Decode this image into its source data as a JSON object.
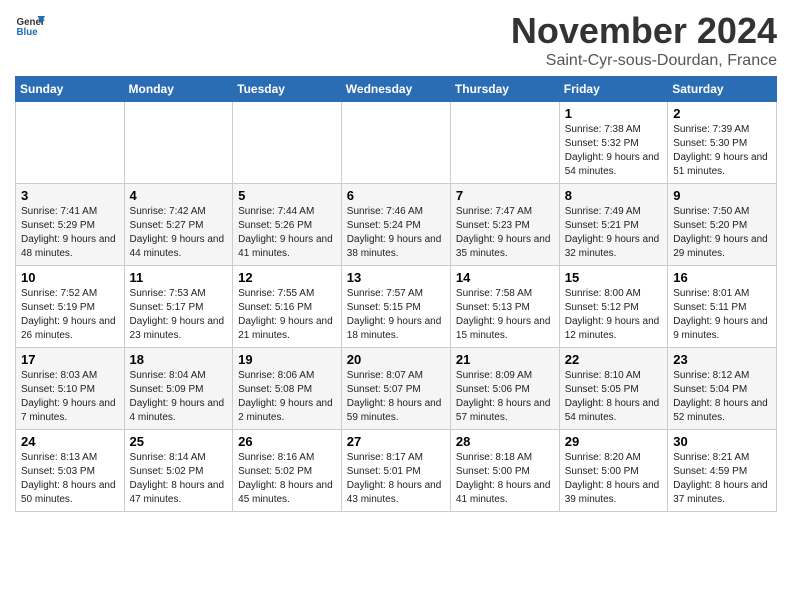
{
  "header": {
    "logo_line1": "General",
    "logo_line2": "Blue",
    "month": "November 2024",
    "location": "Saint-Cyr-sous-Dourdan, France"
  },
  "weekdays": [
    "Sunday",
    "Monday",
    "Tuesday",
    "Wednesday",
    "Thursday",
    "Friday",
    "Saturday"
  ],
  "weeks": [
    [
      {
        "day": "",
        "info": ""
      },
      {
        "day": "",
        "info": ""
      },
      {
        "day": "",
        "info": ""
      },
      {
        "day": "",
        "info": ""
      },
      {
        "day": "",
        "info": ""
      },
      {
        "day": "1",
        "info": "Sunrise: 7:38 AM\nSunset: 5:32 PM\nDaylight: 9 hours and 54 minutes."
      },
      {
        "day": "2",
        "info": "Sunrise: 7:39 AM\nSunset: 5:30 PM\nDaylight: 9 hours and 51 minutes."
      }
    ],
    [
      {
        "day": "3",
        "info": "Sunrise: 7:41 AM\nSunset: 5:29 PM\nDaylight: 9 hours and 48 minutes."
      },
      {
        "day": "4",
        "info": "Sunrise: 7:42 AM\nSunset: 5:27 PM\nDaylight: 9 hours and 44 minutes."
      },
      {
        "day": "5",
        "info": "Sunrise: 7:44 AM\nSunset: 5:26 PM\nDaylight: 9 hours and 41 minutes."
      },
      {
        "day": "6",
        "info": "Sunrise: 7:46 AM\nSunset: 5:24 PM\nDaylight: 9 hours and 38 minutes."
      },
      {
        "day": "7",
        "info": "Sunrise: 7:47 AM\nSunset: 5:23 PM\nDaylight: 9 hours and 35 minutes."
      },
      {
        "day": "8",
        "info": "Sunrise: 7:49 AM\nSunset: 5:21 PM\nDaylight: 9 hours and 32 minutes."
      },
      {
        "day": "9",
        "info": "Sunrise: 7:50 AM\nSunset: 5:20 PM\nDaylight: 9 hours and 29 minutes."
      }
    ],
    [
      {
        "day": "10",
        "info": "Sunrise: 7:52 AM\nSunset: 5:19 PM\nDaylight: 9 hours and 26 minutes."
      },
      {
        "day": "11",
        "info": "Sunrise: 7:53 AM\nSunset: 5:17 PM\nDaylight: 9 hours and 23 minutes."
      },
      {
        "day": "12",
        "info": "Sunrise: 7:55 AM\nSunset: 5:16 PM\nDaylight: 9 hours and 21 minutes."
      },
      {
        "day": "13",
        "info": "Sunrise: 7:57 AM\nSunset: 5:15 PM\nDaylight: 9 hours and 18 minutes."
      },
      {
        "day": "14",
        "info": "Sunrise: 7:58 AM\nSunset: 5:13 PM\nDaylight: 9 hours and 15 minutes."
      },
      {
        "day": "15",
        "info": "Sunrise: 8:00 AM\nSunset: 5:12 PM\nDaylight: 9 hours and 12 minutes."
      },
      {
        "day": "16",
        "info": "Sunrise: 8:01 AM\nSunset: 5:11 PM\nDaylight: 9 hours and 9 minutes."
      }
    ],
    [
      {
        "day": "17",
        "info": "Sunrise: 8:03 AM\nSunset: 5:10 PM\nDaylight: 9 hours and 7 minutes."
      },
      {
        "day": "18",
        "info": "Sunrise: 8:04 AM\nSunset: 5:09 PM\nDaylight: 9 hours and 4 minutes."
      },
      {
        "day": "19",
        "info": "Sunrise: 8:06 AM\nSunset: 5:08 PM\nDaylight: 9 hours and 2 minutes."
      },
      {
        "day": "20",
        "info": "Sunrise: 8:07 AM\nSunset: 5:07 PM\nDaylight: 8 hours and 59 minutes."
      },
      {
        "day": "21",
        "info": "Sunrise: 8:09 AM\nSunset: 5:06 PM\nDaylight: 8 hours and 57 minutes."
      },
      {
        "day": "22",
        "info": "Sunrise: 8:10 AM\nSunset: 5:05 PM\nDaylight: 8 hours and 54 minutes."
      },
      {
        "day": "23",
        "info": "Sunrise: 8:12 AM\nSunset: 5:04 PM\nDaylight: 8 hours and 52 minutes."
      }
    ],
    [
      {
        "day": "24",
        "info": "Sunrise: 8:13 AM\nSunset: 5:03 PM\nDaylight: 8 hours and 50 minutes."
      },
      {
        "day": "25",
        "info": "Sunrise: 8:14 AM\nSunset: 5:02 PM\nDaylight: 8 hours and 47 minutes."
      },
      {
        "day": "26",
        "info": "Sunrise: 8:16 AM\nSunset: 5:02 PM\nDaylight: 8 hours and 45 minutes."
      },
      {
        "day": "27",
        "info": "Sunrise: 8:17 AM\nSunset: 5:01 PM\nDaylight: 8 hours and 43 minutes."
      },
      {
        "day": "28",
        "info": "Sunrise: 8:18 AM\nSunset: 5:00 PM\nDaylight: 8 hours and 41 minutes."
      },
      {
        "day": "29",
        "info": "Sunrise: 8:20 AM\nSunset: 5:00 PM\nDaylight: 8 hours and 39 minutes."
      },
      {
        "day": "30",
        "info": "Sunrise: 8:21 AM\nSunset: 4:59 PM\nDaylight: 8 hours and 37 minutes."
      }
    ]
  ]
}
